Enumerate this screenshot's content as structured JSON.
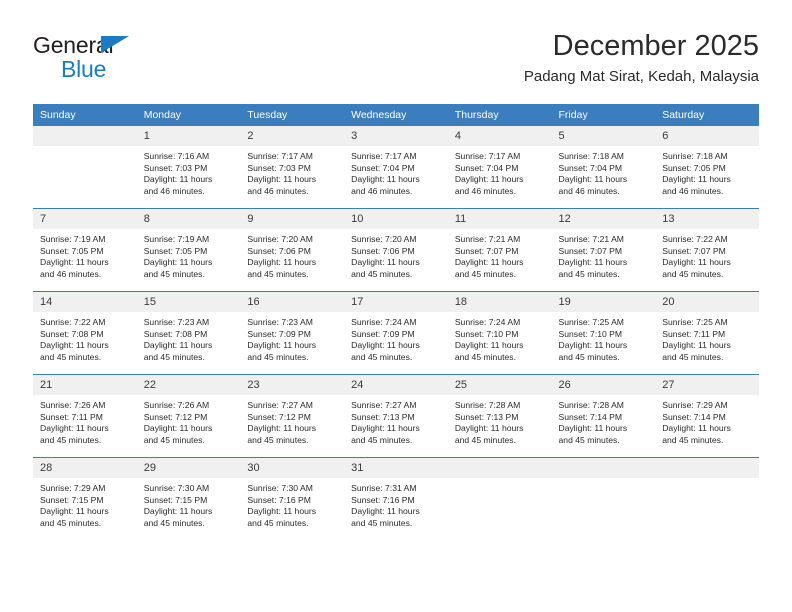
{
  "brand": {
    "name_line1": "General",
    "name_line2": "Blue",
    "accent_color": "#1a7dc4"
  },
  "header": {
    "title": "December 2025",
    "subtitle": "Padang Mat Sirat, Kedah, Malaysia"
  },
  "theme": {
    "header_bg": "#3a7ebf",
    "daynum_bg": "#f0f0f0",
    "text": "#2b2b2b"
  },
  "weekday_headers": [
    "Sunday",
    "Monday",
    "Tuesday",
    "Wednesday",
    "Thursday",
    "Friday",
    "Saturday"
  ],
  "weeks": [
    [
      {
        "day": "",
        "lines": []
      },
      {
        "day": "1",
        "lines": [
          "Sunrise: 7:16 AM",
          "Sunset: 7:03 PM",
          "Daylight: 11 hours",
          "and 46 minutes."
        ]
      },
      {
        "day": "2",
        "lines": [
          "Sunrise: 7:17 AM",
          "Sunset: 7:03 PM",
          "Daylight: 11 hours",
          "and 46 minutes."
        ]
      },
      {
        "day": "3",
        "lines": [
          "Sunrise: 7:17 AM",
          "Sunset: 7:04 PM",
          "Daylight: 11 hours",
          "and 46 minutes."
        ]
      },
      {
        "day": "4",
        "lines": [
          "Sunrise: 7:17 AM",
          "Sunset: 7:04 PM",
          "Daylight: 11 hours",
          "and 46 minutes."
        ]
      },
      {
        "day": "5",
        "lines": [
          "Sunrise: 7:18 AM",
          "Sunset: 7:04 PM",
          "Daylight: 11 hours",
          "and 46 minutes."
        ]
      },
      {
        "day": "6",
        "lines": [
          "Sunrise: 7:18 AM",
          "Sunset: 7:05 PM",
          "Daylight: 11 hours",
          "and 46 minutes."
        ]
      }
    ],
    [
      {
        "day": "7",
        "lines": [
          "Sunrise: 7:19 AM",
          "Sunset: 7:05 PM",
          "Daylight: 11 hours",
          "and 46 minutes."
        ]
      },
      {
        "day": "8",
        "lines": [
          "Sunrise: 7:19 AM",
          "Sunset: 7:05 PM",
          "Daylight: 11 hours",
          "and 45 minutes."
        ]
      },
      {
        "day": "9",
        "lines": [
          "Sunrise: 7:20 AM",
          "Sunset: 7:06 PM",
          "Daylight: 11 hours",
          "and 45 minutes."
        ]
      },
      {
        "day": "10",
        "lines": [
          "Sunrise: 7:20 AM",
          "Sunset: 7:06 PM",
          "Daylight: 11 hours",
          "and 45 minutes."
        ]
      },
      {
        "day": "11",
        "lines": [
          "Sunrise: 7:21 AM",
          "Sunset: 7:07 PM",
          "Daylight: 11 hours",
          "and 45 minutes."
        ]
      },
      {
        "day": "12",
        "lines": [
          "Sunrise: 7:21 AM",
          "Sunset: 7:07 PM",
          "Daylight: 11 hours",
          "and 45 minutes."
        ]
      },
      {
        "day": "13",
        "lines": [
          "Sunrise: 7:22 AM",
          "Sunset: 7:07 PM",
          "Daylight: 11 hours",
          "and 45 minutes."
        ]
      }
    ],
    [
      {
        "day": "14",
        "lines": [
          "Sunrise: 7:22 AM",
          "Sunset: 7:08 PM",
          "Daylight: 11 hours",
          "and 45 minutes."
        ]
      },
      {
        "day": "15",
        "lines": [
          "Sunrise: 7:23 AM",
          "Sunset: 7:08 PM",
          "Daylight: 11 hours",
          "and 45 minutes."
        ]
      },
      {
        "day": "16",
        "lines": [
          "Sunrise: 7:23 AM",
          "Sunset: 7:09 PM",
          "Daylight: 11 hours",
          "and 45 minutes."
        ]
      },
      {
        "day": "17",
        "lines": [
          "Sunrise: 7:24 AM",
          "Sunset: 7:09 PM",
          "Daylight: 11 hours",
          "and 45 minutes."
        ]
      },
      {
        "day": "18",
        "lines": [
          "Sunrise: 7:24 AM",
          "Sunset: 7:10 PM",
          "Daylight: 11 hours",
          "and 45 minutes."
        ]
      },
      {
        "day": "19",
        "lines": [
          "Sunrise: 7:25 AM",
          "Sunset: 7:10 PM",
          "Daylight: 11 hours",
          "and 45 minutes."
        ]
      },
      {
        "day": "20",
        "lines": [
          "Sunrise: 7:25 AM",
          "Sunset: 7:11 PM",
          "Daylight: 11 hours",
          "and 45 minutes."
        ]
      }
    ],
    [
      {
        "day": "21",
        "lines": [
          "Sunrise: 7:26 AM",
          "Sunset: 7:11 PM",
          "Daylight: 11 hours",
          "and 45 minutes."
        ]
      },
      {
        "day": "22",
        "lines": [
          "Sunrise: 7:26 AM",
          "Sunset: 7:12 PM",
          "Daylight: 11 hours",
          "and 45 minutes."
        ]
      },
      {
        "day": "23",
        "lines": [
          "Sunrise: 7:27 AM",
          "Sunset: 7:12 PM",
          "Daylight: 11 hours",
          "and 45 minutes."
        ]
      },
      {
        "day": "24",
        "lines": [
          "Sunrise: 7:27 AM",
          "Sunset: 7:13 PM",
          "Daylight: 11 hours",
          "and 45 minutes."
        ]
      },
      {
        "day": "25",
        "lines": [
          "Sunrise: 7:28 AM",
          "Sunset: 7:13 PM",
          "Daylight: 11 hours",
          "and 45 minutes."
        ]
      },
      {
        "day": "26",
        "lines": [
          "Sunrise: 7:28 AM",
          "Sunset: 7:14 PM",
          "Daylight: 11 hours",
          "and 45 minutes."
        ]
      },
      {
        "day": "27",
        "lines": [
          "Sunrise: 7:29 AM",
          "Sunset: 7:14 PM",
          "Daylight: 11 hours",
          "and 45 minutes."
        ]
      }
    ],
    [
      {
        "day": "28",
        "lines": [
          "Sunrise: 7:29 AM",
          "Sunset: 7:15 PM",
          "Daylight: 11 hours",
          "and 45 minutes."
        ]
      },
      {
        "day": "29",
        "lines": [
          "Sunrise: 7:30 AM",
          "Sunset: 7:15 PM",
          "Daylight: 11 hours",
          "and 45 minutes."
        ]
      },
      {
        "day": "30",
        "lines": [
          "Sunrise: 7:30 AM",
          "Sunset: 7:16 PM",
          "Daylight: 11 hours",
          "and 45 minutes."
        ]
      },
      {
        "day": "31",
        "lines": [
          "Sunrise: 7:31 AM",
          "Sunset: 7:16 PM",
          "Daylight: 11 hours",
          "and 45 minutes."
        ]
      },
      {
        "day": "",
        "lines": []
      },
      {
        "day": "",
        "lines": []
      },
      {
        "day": "",
        "lines": []
      }
    ]
  ]
}
